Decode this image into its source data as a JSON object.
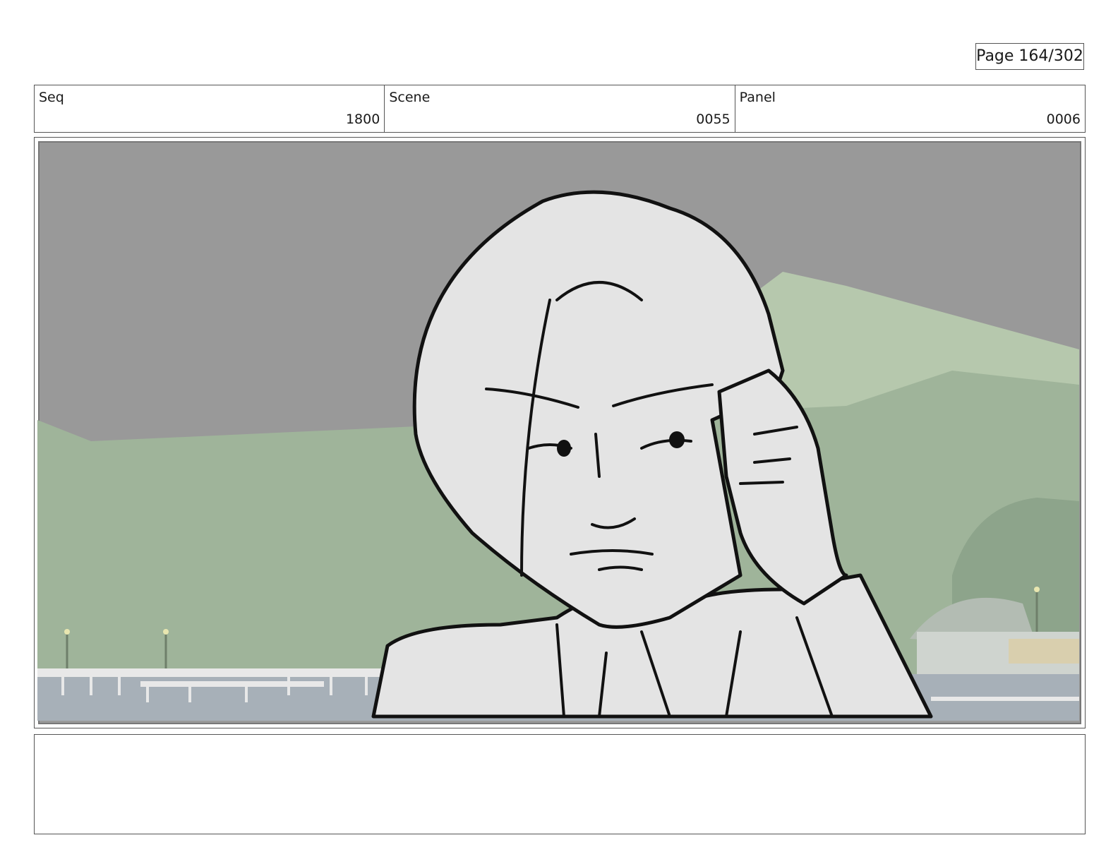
{
  "page": {
    "label": "Page 164/302"
  },
  "info": {
    "seq_label": "Seq",
    "seq_value": "1800",
    "scene_label": "Scene",
    "scene_value": "0055",
    "panel_label": "Panel",
    "panel_value": "0006"
  },
  "notes": {
    "text": ""
  },
  "colors": {
    "sky": "#9a9a9a",
    "hill_near": "#9fb49a",
    "hill_far": "#b6c8ad",
    "water": "#a7b0b8",
    "sketch_fill": "#e4e4e4",
    "ink": "#111111"
  }
}
